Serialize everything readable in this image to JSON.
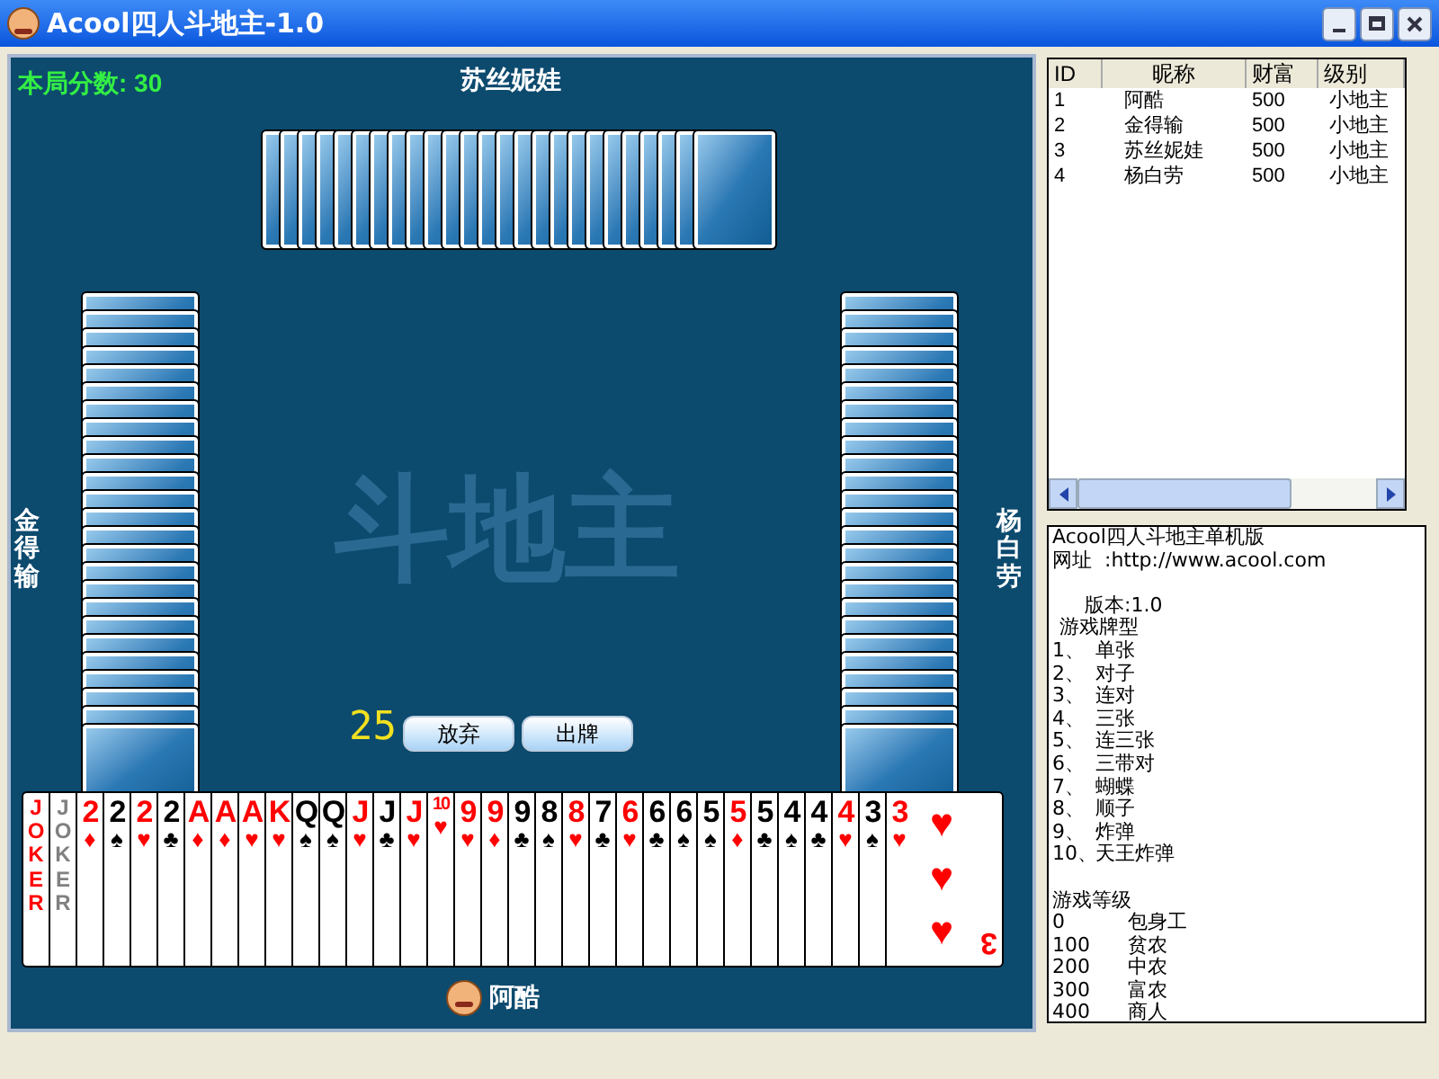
{
  "window": {
    "title": "Acool四人斗地主-1.0"
  },
  "game": {
    "score": "本局分数: 30",
    "logo": "斗地主",
    "timer": "25",
    "buttons": [
      {
        "label": "放弃"
      },
      {
        "label": "出牌"
      }
    ],
    "players": {
      "top": {
        "name": "苏丝妮娃"
      },
      "left": {
        "name": "金得输"
      },
      "right": {
        "name": "杨白劳"
      },
      "bottom": {
        "name": "阿酷"
      }
    },
    "hand": [
      {
        "kind": "joker",
        "rank": "JOKER",
        "color": "#ff0000"
      },
      {
        "kind": "joker",
        "rank": "JOKER",
        "color": "#808080"
      },
      {
        "kind": "card",
        "rank": "2",
        "suit": "♦",
        "color": "#ff0000"
      },
      {
        "kind": "card",
        "rank": "2",
        "suit": "♠",
        "color": "#000000"
      },
      {
        "kind": "card",
        "rank": "2",
        "suit": "♥",
        "color": "#ff0000"
      },
      {
        "kind": "card",
        "rank": "2",
        "suit": "♣",
        "color": "#000000"
      },
      {
        "kind": "card",
        "rank": "A",
        "suit": "♦",
        "color": "#ff0000"
      },
      {
        "kind": "card",
        "rank": "A",
        "suit": "♦",
        "color": "#ff0000"
      },
      {
        "kind": "card",
        "rank": "A",
        "suit": "♥",
        "color": "#ff0000"
      },
      {
        "kind": "card",
        "rank": "K",
        "suit": "♥",
        "color": "#ff0000"
      },
      {
        "kind": "card",
        "rank": "Q",
        "suit": "♠",
        "color": "#000000"
      },
      {
        "kind": "card",
        "rank": "Q",
        "suit": "♠",
        "color": "#000000"
      },
      {
        "kind": "card",
        "rank": "J",
        "suit": "♥",
        "color": "#ff0000"
      },
      {
        "kind": "card",
        "rank": "J",
        "suit": "♣",
        "color": "#000000"
      },
      {
        "kind": "card",
        "rank": "J",
        "suit": "♥",
        "color": "#ff0000"
      },
      {
        "kind": "card",
        "rank": "10",
        "suit": "♥",
        "color": "#ff0000"
      },
      {
        "kind": "card",
        "rank": "9",
        "suit": "♥",
        "color": "#ff0000"
      },
      {
        "kind": "card",
        "rank": "9",
        "suit": "♦",
        "color": "#ff0000"
      },
      {
        "kind": "card",
        "rank": "9",
        "suit": "♣",
        "color": "#000000"
      },
      {
        "kind": "card",
        "rank": "8",
        "suit": "♠",
        "color": "#000000"
      },
      {
        "kind": "card",
        "rank": "8",
        "suit": "♥",
        "color": "#ff0000"
      },
      {
        "kind": "card",
        "rank": "7",
        "suit": "♣",
        "color": "#000000"
      },
      {
        "kind": "card",
        "rank": "6",
        "suit": "♥",
        "color": "#ff0000"
      },
      {
        "kind": "card",
        "rank": "6",
        "suit": "♣",
        "color": "#000000"
      },
      {
        "kind": "card",
        "rank": "6",
        "suit": "♠",
        "color": "#000000"
      },
      {
        "kind": "card",
        "rank": "5",
        "suit": "♠",
        "color": "#000000"
      },
      {
        "kind": "card",
        "rank": "5",
        "suit": "♦",
        "color": "#ff0000"
      },
      {
        "kind": "card",
        "rank": "5",
        "suit": "♣",
        "color": "#000000"
      },
      {
        "kind": "card",
        "rank": "4",
        "suit": "♠",
        "color": "#000000"
      },
      {
        "kind": "card",
        "rank": "4",
        "suit": "♣",
        "color": "#000000"
      },
      {
        "kind": "card",
        "rank": "4",
        "suit": "♥",
        "color": "#ff0000"
      },
      {
        "kind": "card",
        "rank": "3",
        "suit": "♠",
        "color": "#000000"
      },
      {
        "kind": "card",
        "rank": "3",
        "suit": "♥",
        "color": "#ff0000",
        "pips": [
          "♥",
          "♥",
          "♥"
        ],
        "bottom_rank": "3"
      }
    ]
  },
  "players_table": {
    "columns": [
      "ID",
      "昵称",
      "财富",
      "级别"
    ],
    "rows": [
      [
        "1",
        "阿酷",
        "500",
        "小地主"
      ],
      [
        "2",
        "金得输",
        "500",
        "小地主"
      ],
      [
        "3",
        "苏丝妮娃",
        "500",
        "小地主"
      ],
      [
        "4",
        "杨白劳",
        "500",
        "小地主"
      ]
    ]
  },
  "info": {
    "title": "Acool四人斗地主单机版",
    "website": "网址  :http://www.acool.com",
    "version": "版本:1.0",
    "types_heading": "游戏牌型",
    "types": [
      {
        "num": "1、",
        "name": "单张"
      },
      {
        "num": "2、",
        "name": "对子"
      },
      {
        "num": "3、",
        "name": "连对"
      },
      {
        "num": "4、",
        "name": "三张"
      },
      {
        "num": "5、",
        "name": "连三张"
      },
      {
        "num": "6、",
        "name": "三带对"
      },
      {
        "num": "7、",
        "name": "蝴蝶"
      },
      {
        "num": "8、",
        "name": "顺子"
      },
      {
        "num": "9、",
        "name": "炸弹"
      },
      {
        "num": "10、",
        "name": "天王炸弹"
      }
    ],
    "levels_heading": "游戏等级",
    "levels": [
      {
        "points": "0",
        "name": "包身工"
      },
      {
        "points": "100",
        "name": "贫农"
      },
      {
        "points": "200",
        "name": "中农"
      },
      {
        "points": "300",
        "name": "富农"
      },
      {
        "points": "400",
        "name": "商人"
      }
    ]
  }
}
